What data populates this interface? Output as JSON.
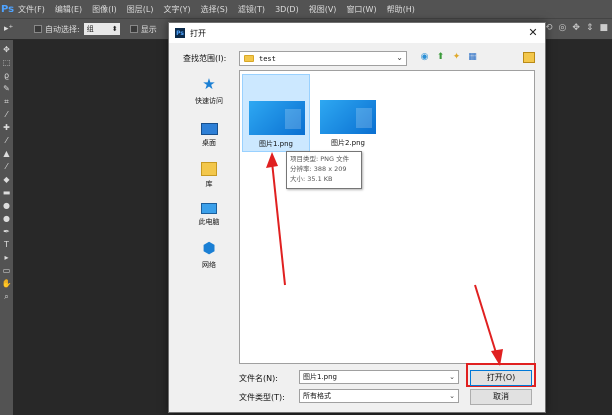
{
  "ps": {
    "logo": "Ps",
    "menu": [
      "文件(F)",
      "编辑(E)",
      "图像(I)",
      "图层(L)",
      "文字(Y)",
      "选择(S)",
      "滤镜(T)",
      "3D(D)",
      "视图(V)",
      "窗口(W)",
      "帮助(H)"
    ],
    "options": {
      "tool_glyph": "▸⁺",
      "auto_select_label": "自动选择:",
      "auto_select_value": "组",
      "show_label": "显示"
    }
  },
  "dialog": {
    "title": "打开",
    "close": "✕",
    "look_in_label": "查找范围(I):",
    "look_in_value": "test",
    "places": [
      {
        "label": "快速访问",
        "icon": "star-icon"
      },
      {
        "label": "桌面",
        "icon": "desktop-icon"
      },
      {
        "label": "库",
        "icon": "library-icon"
      },
      {
        "label": "此电脑",
        "icon": "computer-icon"
      },
      {
        "label": "网络",
        "icon": "network-icon"
      }
    ],
    "files": [
      {
        "name": "图片1.png",
        "selected": true
      },
      {
        "name": "图片2.png",
        "selected": false
      }
    ],
    "tooltip": {
      "type": "项目类型: PNG 文件",
      "dimensions": "分辨率: 388 x 209",
      "size": "大小: 35.1 KB"
    },
    "filename_label": "文件名(N):",
    "filename_value": "图片1.png",
    "filetype_label": "文件类型(T):",
    "filetype_value": "所有格式",
    "open_label": "打开(O)",
    "cancel_label": "取消"
  },
  "colors": {
    "annotation": "#e02020",
    "thumbnail": "#1a8ae6"
  }
}
